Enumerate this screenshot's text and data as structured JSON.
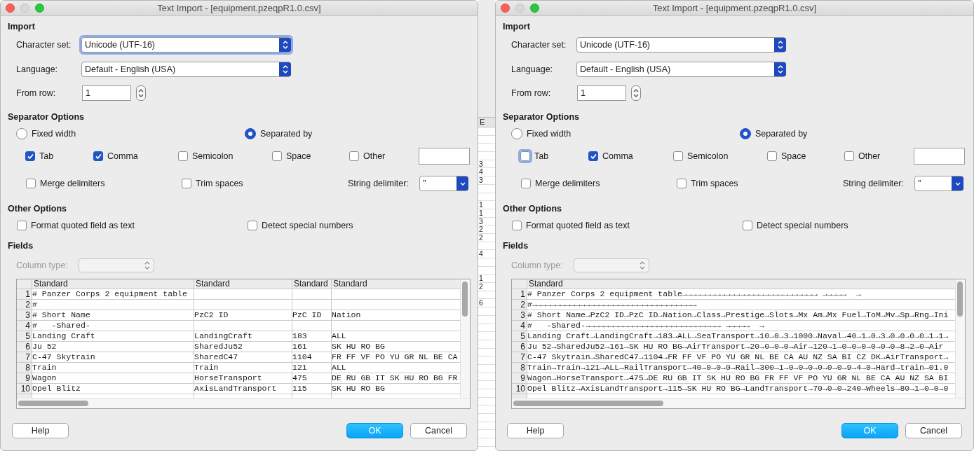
{
  "background_sheet": {
    "column_header": "E",
    "cells": [
      null,
      null,
      null,
      null,
      "3",
      "4",
      "3",
      null,
      null,
      "1",
      "1",
      "3",
      "2",
      "2",
      null,
      "4",
      null,
      null,
      "1",
      "2",
      null,
      "6",
      null,
      null,
      null,
      null,
      null,
      null,
      null,
      null,
      null,
      null,
      null,
      null,
      null,
      null,
      null,
      null,
      null,
      null
    ]
  },
  "dialogs": [
    {
      "title": "Text Import - [equipment.pzeqpR1.0.csv]",
      "import": {
        "heading": "Import",
        "character_set": {
          "label": "Character set:",
          "value": "Unicode (UTF-16)",
          "focused": true
        },
        "language": {
          "label": "Language:",
          "value": "Default - English (USA)",
          "focused": false
        },
        "from_row": {
          "label": "From row:",
          "value": "1"
        }
      },
      "separator_options": {
        "heading": "Separator Options",
        "modes": [
          {
            "label": "Fixed width",
            "selected": false
          },
          {
            "label": "Separated by",
            "selected": true
          }
        ],
        "separators": [
          {
            "label": "Tab",
            "checked": true,
            "focused": false
          },
          {
            "label": "Comma",
            "checked": true,
            "focused": false
          },
          {
            "label": "Semicolon",
            "checked": false,
            "focused": false
          },
          {
            "label": "Space",
            "checked": false,
            "focused": false
          },
          {
            "label": "Other",
            "checked": false,
            "focused": false
          }
        ],
        "merge_delimiters": {
          "label": "Merge delimiters",
          "checked": false
        },
        "trim_spaces": {
          "label": "Trim spaces",
          "checked": false
        },
        "string_delimiter": {
          "label": "String delimiter:",
          "value": "\""
        }
      },
      "other_options": {
        "heading": "Other Options",
        "options": [
          {
            "label": "Format quoted field as text",
            "checked": false
          },
          {
            "label": "Detect special numbers",
            "checked": false
          }
        ]
      },
      "fields": {
        "heading": "Fields",
        "column_type": {
          "label": "Column type:",
          "disabled": true
        },
        "columns": [
          "Standard",
          "Standard",
          "Standard",
          "Standard"
        ],
        "rows": [
          {
            "number": "1",
            "cells": [
              "# Panzer Corps 2 equipment table",
              null,
              null,
              null
            ]
          },
          {
            "number": "2",
            "cells": [
              "#",
              null,
              null,
              null
            ]
          },
          {
            "number": "3",
            "cells": [
              "# Short Name",
              "PzC2 ID",
              "PzC ID",
              "Nation"
            ]
          },
          {
            "number": "4",
            "cells": [
              "#   -Shared-",
              null,
              null,
              null
            ]
          },
          {
            "number": "5",
            "cells": [
              "Landing Craft",
              "LandingCraft",
              "183",
              "ALL"
            ]
          },
          {
            "number": "6",
            "cells": [
              "Ju 52",
              "SharedJu52",
              "161",
              "SK HU RO BG"
            ]
          },
          {
            "number": "7",
            "cells": [
              "C-47 Skytrain",
              "SharedC47",
              "1104",
              "FR FF VF PO YU GR NL BE CA"
            ]
          },
          {
            "number": "8",
            "cells": [
              "Train",
              "Train",
              "121",
              "ALL"
            ]
          },
          {
            "number": "9",
            "cells": [
              "Wagon",
              "HorseTransport",
              "475",
              "DE RU GB IT SK HU RO BG FR"
            ]
          },
          {
            "number": "10",
            "cells": [
              "Opel Blitz",
              "AxisLandTransport",
              "115",
              "SK HU RO BG"
            ]
          }
        ]
      },
      "buttons": [
        {
          "label": "Help",
          "kind": "plain"
        },
        {
          "label": "OK",
          "kind": "default"
        },
        {
          "label": "Cancel",
          "kind": "plain"
        }
      ]
    },
    {
      "title": "Text Import - [equipment.pzeqpR1.0.csv]",
      "import": {
        "heading": "Import",
        "character_set": {
          "label": "Character set:",
          "value": "Unicode (UTF-16)",
          "focused": false
        },
        "language": {
          "label": "Language:",
          "value": "Default - English (USA)",
          "focused": false
        },
        "from_row": {
          "label": "From row:",
          "value": "1"
        }
      },
      "separator_options": {
        "heading": "Separator Options",
        "modes": [
          {
            "label": "Fixed width",
            "selected": false
          },
          {
            "label": "Separated by",
            "selected": true
          }
        ],
        "separators": [
          {
            "label": "Tab",
            "checked": false,
            "focused": true
          },
          {
            "label": "Comma",
            "checked": true,
            "focused": false
          },
          {
            "label": "Semicolon",
            "checked": false,
            "focused": false
          },
          {
            "label": "Space",
            "checked": false,
            "focused": false
          },
          {
            "label": "Other",
            "checked": false,
            "focused": false
          }
        ],
        "merge_delimiters": {
          "label": "Merge delimiters",
          "checked": false
        },
        "trim_spaces": {
          "label": "Trim spaces",
          "checked": false
        },
        "string_delimiter": {
          "label": "String delimiter:",
          "value": "\""
        }
      },
      "other_options": {
        "heading": "Other Options",
        "options": [
          {
            "label": "Format quoted field as text",
            "checked": false
          },
          {
            "label": "Detect special numbers",
            "checked": false
          }
        ]
      },
      "fields": {
        "heading": "Fields",
        "column_type": {
          "label": "Column type:",
          "disabled": true
        },
        "columns": [
          "Standard"
        ],
        "rows": [
          {
            "number": "1",
            "cells": [
              "# Panzer Corps 2 equipment table→→→→→→→→→→→→→→→→→→→→→→→→→→→→ →→→→→  →"
            ]
          },
          {
            "number": "2",
            "cells": [
              "#→→→→→→→→→→→→→→→→→→→→→→→→→→→→→→→→→→"
            ]
          },
          {
            "number": "3",
            "cells": [
              "# Short Name→PzC2 ID→PzC ID→Nation→Class→Prestige→Slots→Mx Am→Mx Fuel→ToM→Mv→Sp→Rng→Ini"
            ]
          },
          {
            "number": "4",
            "cells": [
              "#   -Shared-→→→→→→→→→→→→→→→→→→→→→→→→→→→→ →→→→→  →"
            ]
          },
          {
            "number": "5",
            "cells": [
              "Landing Craft→LandingCraft→183→ALL→SeaTransport→10→0→3→1000→Naval→40→1→0→3→0→0→0→0→1→1→"
            ]
          },
          {
            "number": "6",
            "cells": [
              "Ju 52→SharedJu52→161→SK HU RO BG→AirTransport→20→0→0→0→Air→120→1→0→0→0→0→0→0→8→2→0→Air"
            ]
          },
          {
            "number": "7",
            "cells": [
              "C-47 Skytrain→SharedC47→1104→FR FF VF PO YU GR NL BE CA AU NZ SA BI CZ DK→AirTransport→"
            ]
          },
          {
            "number": "8",
            "cells": [
              "Train→Train→121→ALL→RailTransport→40→0→0→0→Rail→300→1→0→0→0→0→0→0→9→4→0→Hard→train→01.0"
            ]
          },
          {
            "number": "9",
            "cells": [
              "Wagon→HorseTransport→475→DE RU GB IT SK HU RO BG FR FF VF PO YU GR NL BE CA AU NZ SA BI"
            ]
          },
          {
            "number": "10",
            "cells": [
              "Opel Blitz→AxisLandTransport→115→SK HU RO BG→LandTransport→70→0→0→240→Wheels→80→1→0→0→0"
            ]
          }
        ]
      },
      "buttons": [
        {
          "label": "Help",
          "kind": "plain"
        },
        {
          "label": "OK",
          "kind": "default"
        },
        {
          "label": "Cancel",
          "kind": "plain"
        }
      ]
    }
  ]
}
